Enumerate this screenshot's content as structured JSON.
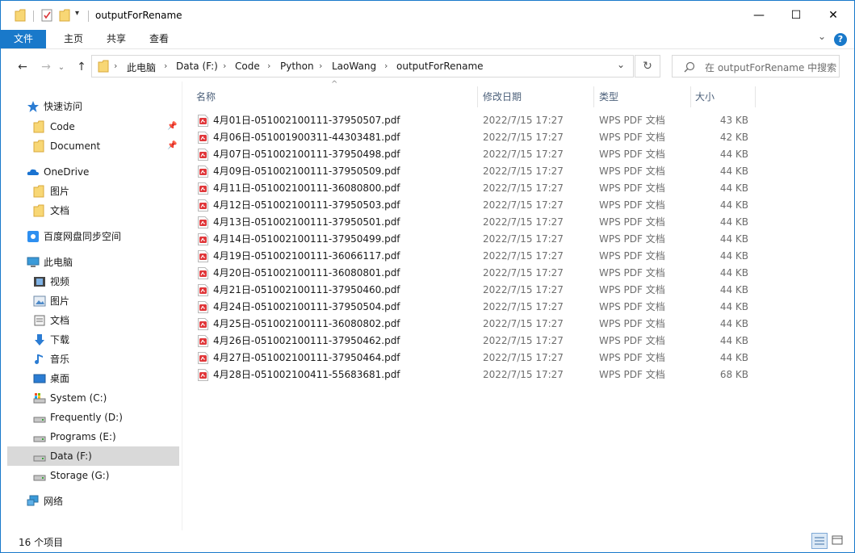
{
  "window": {
    "title": "outputForRename",
    "minimize_glyph": "—",
    "maximize_glyph": "☐",
    "close_glyph": "✕"
  },
  "ribbon": {
    "tabs": [
      "文件",
      "主页",
      "共享",
      "查看"
    ],
    "collapse_glyph": "⌄",
    "help_glyph": "?"
  },
  "address": {
    "crumbs": [
      "此电脑",
      "Data (F:)",
      "Code",
      "Python",
      "LaoWang",
      "outputForRename"
    ],
    "separator": "›",
    "dropdown_glyph": "⌄",
    "refresh_glyph": "↻"
  },
  "search": {
    "placeholder": "在 outputForRename 中搜索",
    "icon": "search-icon"
  },
  "nav_buttons": {
    "back": "←",
    "forward": "→",
    "recent": "⌄",
    "up": "↑"
  },
  "sidebar": {
    "quick_access": "快速访问",
    "quick_items": [
      "Code",
      "Document"
    ],
    "onedrive": "OneDrive",
    "onedrive_items": [
      "图片",
      "文档"
    ],
    "baidu": "百度网盘同步空间",
    "this_pc": "此电脑",
    "pc_items": [
      "视频",
      "图片",
      "文档",
      "下载",
      "音乐",
      "桌面"
    ],
    "drives": [
      "System (C:)",
      "Frequently (D:)",
      "Programs (E:)",
      "Data (F:)",
      "Storage (G:)"
    ],
    "selected_drive": "Data (F:)",
    "network": "网络",
    "pin_glyph": "📌"
  },
  "columns": {
    "name": "名称",
    "date": "修改日期",
    "type": "类型",
    "size": "大小",
    "sort_glyph": "^"
  },
  "files": [
    {
      "name": "4月01日-051002100111-37950507.pdf",
      "date": "2022/7/15 17:27",
      "type": "WPS PDF 文档",
      "size": "43 KB"
    },
    {
      "name": "4月06日-051001900311-44303481.pdf",
      "date": "2022/7/15 17:27",
      "type": "WPS PDF 文档",
      "size": "42 KB"
    },
    {
      "name": "4月07日-051002100111-37950498.pdf",
      "date": "2022/7/15 17:27",
      "type": "WPS PDF 文档",
      "size": "44 KB"
    },
    {
      "name": "4月09日-051002100111-37950509.pdf",
      "date": "2022/7/15 17:27",
      "type": "WPS PDF 文档",
      "size": "44 KB"
    },
    {
      "name": "4月11日-051002100111-36080800.pdf",
      "date": "2022/7/15 17:27",
      "type": "WPS PDF 文档",
      "size": "44 KB"
    },
    {
      "name": "4月12日-051002100111-37950503.pdf",
      "date": "2022/7/15 17:27",
      "type": "WPS PDF 文档",
      "size": "44 KB"
    },
    {
      "name": "4月13日-051002100111-37950501.pdf",
      "date": "2022/7/15 17:27",
      "type": "WPS PDF 文档",
      "size": "44 KB"
    },
    {
      "name": "4月14日-051002100111-37950499.pdf",
      "date": "2022/7/15 17:27",
      "type": "WPS PDF 文档",
      "size": "44 KB"
    },
    {
      "name": "4月19日-051002100111-36066117.pdf",
      "date": "2022/7/15 17:27",
      "type": "WPS PDF 文档",
      "size": "44 KB"
    },
    {
      "name": "4月20日-051002100111-36080801.pdf",
      "date": "2022/7/15 17:27",
      "type": "WPS PDF 文档",
      "size": "44 KB"
    },
    {
      "name": "4月21日-051002100111-37950460.pdf",
      "date": "2022/7/15 17:27",
      "type": "WPS PDF 文档",
      "size": "44 KB"
    },
    {
      "name": "4月24日-051002100111-37950504.pdf",
      "date": "2022/7/15 17:27",
      "type": "WPS PDF 文档",
      "size": "44 KB"
    },
    {
      "name": "4月25日-051002100111-36080802.pdf",
      "date": "2022/7/15 17:27",
      "type": "WPS PDF 文档",
      "size": "44 KB"
    },
    {
      "name": "4月26日-051002100111-37950462.pdf",
      "date": "2022/7/15 17:27",
      "type": "WPS PDF 文档",
      "size": "44 KB"
    },
    {
      "name": "4月27日-051002100111-37950464.pdf",
      "date": "2022/7/15 17:27",
      "type": "WPS PDF 文档",
      "size": "44 KB"
    },
    {
      "name": "4月28日-051002100411-55683681.pdf",
      "date": "2022/7/15 17:27",
      "type": "WPS PDF 文档",
      "size": "68 KB"
    }
  ],
  "status": {
    "item_count": "16 个项目"
  },
  "colors": {
    "accent": "#1979ca",
    "header_text": "#4c607a",
    "folder": "#f8d775",
    "pdf": "#e0373a",
    "selection": "#d9d9d9"
  }
}
